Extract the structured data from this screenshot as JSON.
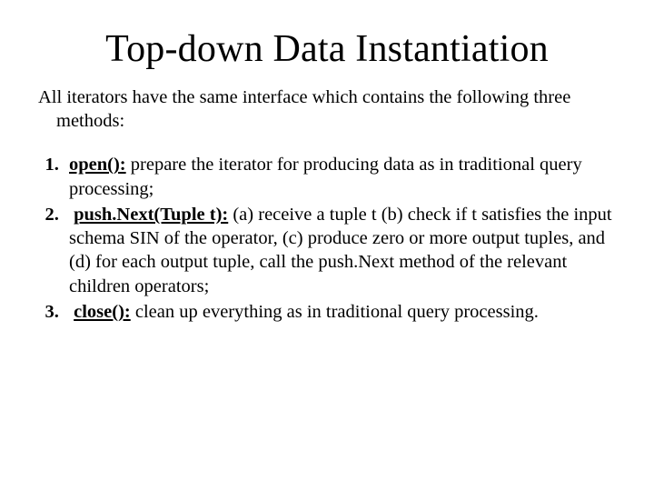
{
  "title": "Top-down Data Instantiation",
  "intro": "All iterators have the same interface which contains the following three methods:",
  "methods": [
    {
      "label": "open():",
      "desc": " prepare the iterator for producing data as in traditional query processing;"
    },
    {
      "label": "push.Next(Tuple t):",
      "desc": " (a) receive a tuple t (b) check if t satisfies the input schema SIN of the operator, (c) produce zero or more output tuples, and (d) for each output tuple, call the push.Next method of the relevant children operators;"
    },
    {
      "label": "close():",
      "desc": " clean up everything as in traditional query processing."
    }
  ]
}
